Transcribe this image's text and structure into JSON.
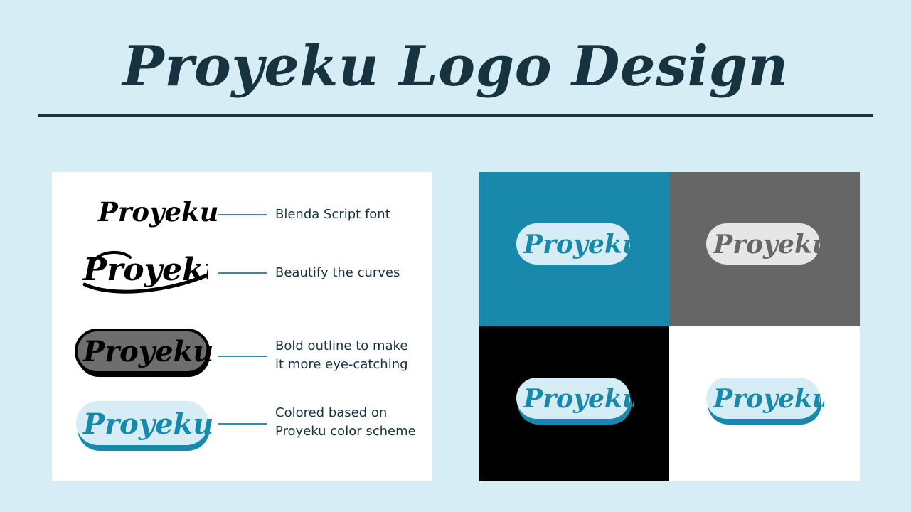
{
  "title": "Proyeku Logo Design",
  "logo_text": "Proyeku",
  "steps": [
    {
      "label": "Blenda Script font"
    },
    {
      "label": "Beautify the curves"
    },
    {
      "label_line1": "Bold outline to make",
      "label_line2": "it more eye-catching"
    },
    {
      "label_line1": "Colored based on",
      "label_line2": "Proyeku color scheme"
    }
  ],
  "colors": {
    "background": "#d6edf5",
    "ink": "#183340",
    "brand_teal": "#1989ab",
    "brand_light": "#d6edf5",
    "gray": "#666666",
    "black": "#000000",
    "white": "#ffffff"
  },
  "variants": [
    "teal-background",
    "gray-background",
    "black-background",
    "white-background"
  ]
}
